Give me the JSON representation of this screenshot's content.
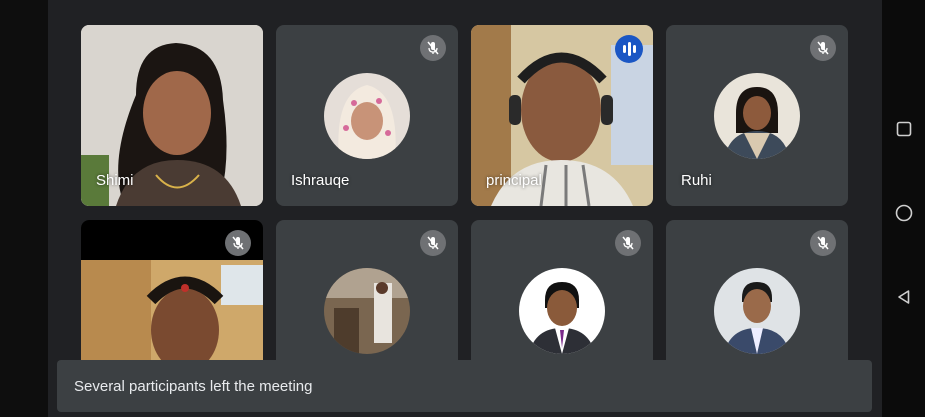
{
  "participants": [
    {
      "name": "Shimi",
      "video": true,
      "muted": false
    },
    {
      "name": "Ishrauqe",
      "video": false,
      "muted": true
    },
    {
      "name": "principal",
      "video": true,
      "speaking": true
    },
    {
      "name": "Ruhi",
      "video": false,
      "muted": true
    },
    {
      "name": "",
      "video": true,
      "muted": true
    },
    {
      "name": "",
      "video": false,
      "muted": true
    },
    {
      "name": "",
      "video": false,
      "muted": true
    },
    {
      "name": "",
      "video": false,
      "muted": true
    }
  ],
  "toast": {
    "message": "Several participants left the meeting"
  },
  "icons": {
    "muted": "mic-off-icon",
    "speaking": "audio-level-icon",
    "nav": [
      "recents-square-icon",
      "home-circle-icon",
      "back-triangle-icon"
    ]
  },
  "colors": {
    "background": "#202124",
    "tile": "#3c4043",
    "accent": "#1a56c4"
  }
}
